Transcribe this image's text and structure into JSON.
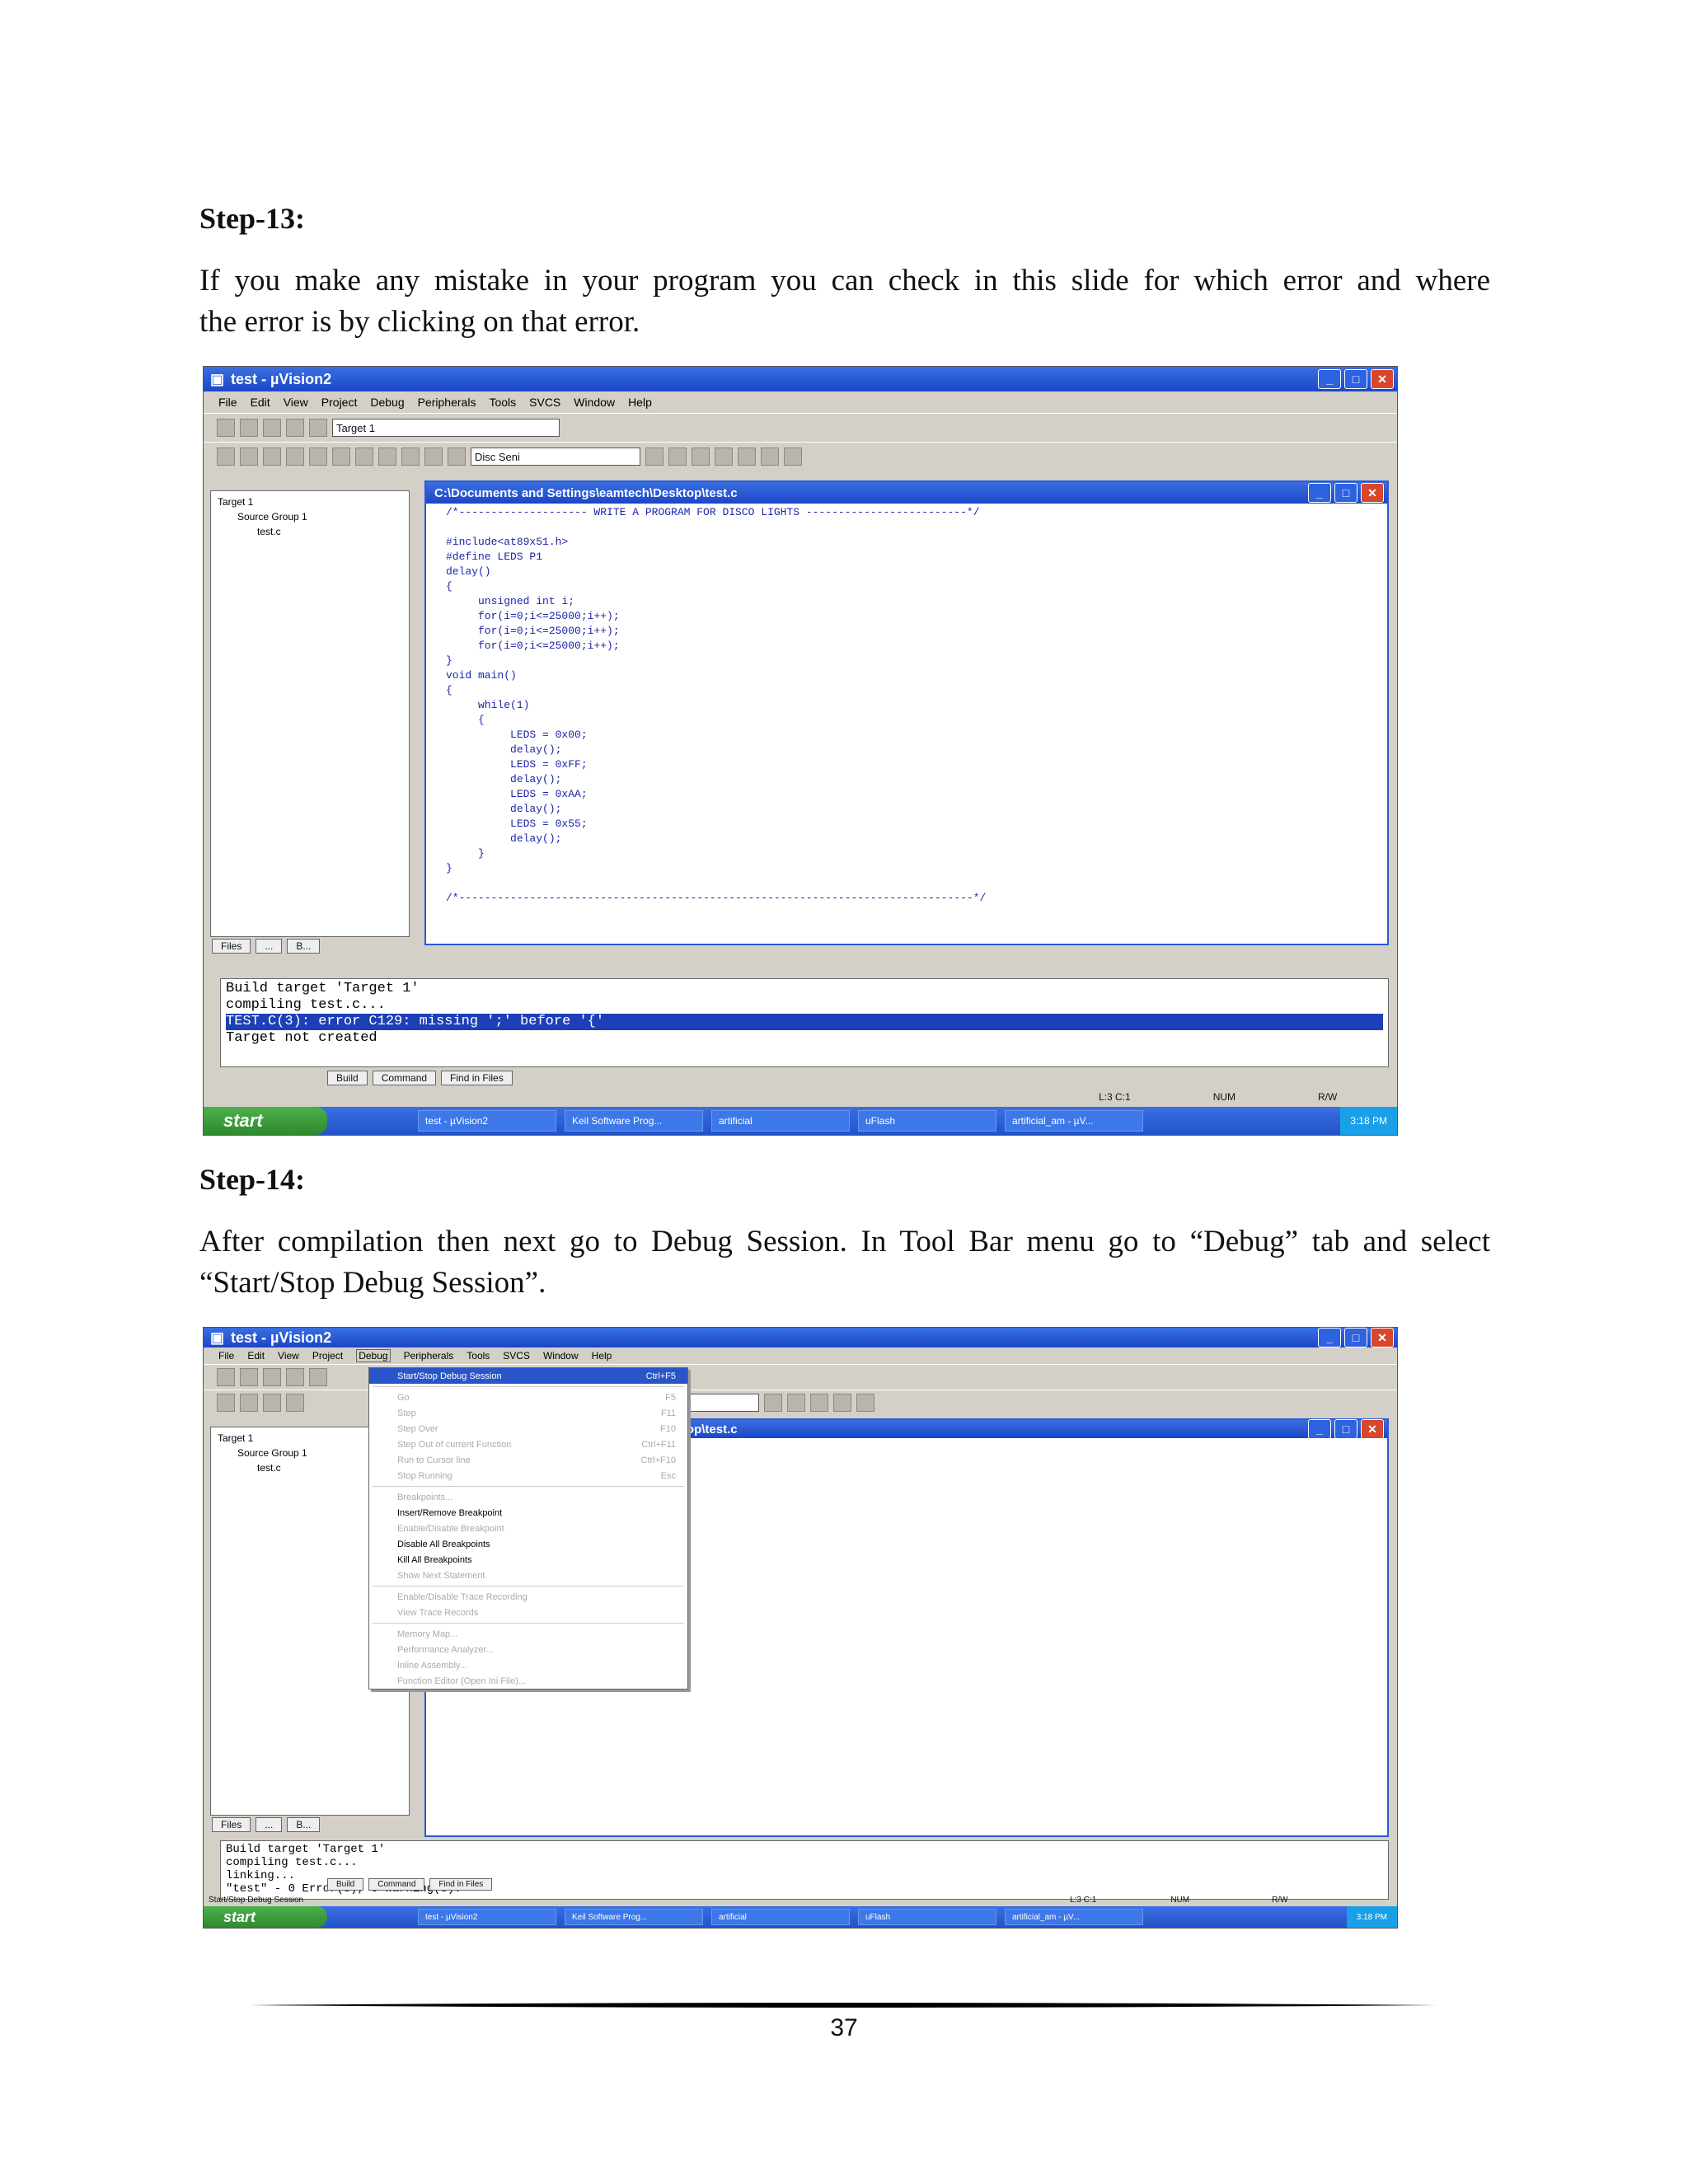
{
  "step13": {
    "heading": "Step-13:",
    "text_line1": "If you make any mistake in your program you can check in this slide for which error and where",
    "text_line2": "the error is by clicking  on that error."
  },
  "step14": {
    "heading": "Step-14:",
    "text_line1": "After compilation then next go to Debug Session. In Tool Bar menu go to “Debug” tab and select",
    "text_line2": "“Start/Stop  Debug  Session”."
  },
  "ide": {
    "title": "test - µVision2",
    "menu": [
      "File",
      "Edit",
      "View",
      "Project",
      "Debug",
      "Peripherals",
      "Tools",
      "SVCS",
      "Window",
      "Help"
    ],
    "target": "Target 1",
    "find_combo": "Disc Seni",
    "tree": {
      "target": "Target 1",
      "group": "Source Group 1",
      "file": "test.c"
    },
    "proj_tabs": [
      "Files",
      "...",
      "B..."
    ],
    "editor_title": "C:\\Documents and Settings\\eamtech\\Desktop\\test.c",
    "code": "/*-------------------- WRITE A PROGRAM FOR DISCO LIGHTS -------------------------*/\n\n#include<at89x51.h>\n#define LEDS P1\ndelay()\n{\n     unsigned int i;\n     for(i=0;i<=25000;i++);\n     for(i=0;i<=25000;i++);\n     for(i=0;i<=25000;i++);\n}\nvoid main()\n{\n     while(1)\n     {\n          LEDS = 0x00;\n          delay();\n          LEDS = 0xFF;\n          delay();\n          LEDS = 0xAA;\n          delay();\n          LEDS = 0x55;\n          delay();\n     }\n}\n\n/*--------------------------------------------------------------------------------*/",
    "output1": [
      "Build target 'Target 1'",
      "compiling test.c...",
      "TEST.C(3): error C129: missing ';' before '{'",
      "Target not created"
    ],
    "output2": [
      "Build target 'Target 1'",
      "compiling test.c...",
      "linking...",
      "\"test\" - 0 Error(s), 0 Warning(s)."
    ],
    "out_tabs": [
      "Build",
      "Command",
      "Find in Files"
    ],
    "status_pos": "L:3 C:1",
    "status_num": "NUM",
    "status_rw": "R/W",
    "status2_left": "Start/Stop Debug Session",
    "taskbar": {
      "start": "start",
      "items": [
        "test - µVision2",
        "Keil Software Prog...",
        "artificial",
        "uFlash",
        "artificial_am - µV..."
      ],
      "clock": "3:18 PM"
    },
    "debug_menu": [
      {
        "label": "Start/Stop Debug Session",
        "sc": "Ctrl+F5",
        "state": "sel"
      },
      {
        "sep": true
      },
      {
        "label": "Go",
        "sc": "F5",
        "state": "dis"
      },
      {
        "label": "Step",
        "sc": "F11",
        "state": "dis"
      },
      {
        "label": "Step Over",
        "sc": "F10",
        "state": "dis"
      },
      {
        "label": "Step Out of current Function",
        "sc": "Ctrl+F11",
        "state": "dis"
      },
      {
        "label": "Run to Cursor line",
        "sc": "Ctrl+F10",
        "state": "dis"
      },
      {
        "label": "Stop Running",
        "sc": "Esc",
        "state": "dis"
      },
      {
        "sep": true
      },
      {
        "label": "Breakpoints...",
        "sc": "",
        "state": "dis"
      },
      {
        "label": "Insert/Remove Breakpoint",
        "sc": "",
        "state": ""
      },
      {
        "label": "Enable/Disable Breakpoint",
        "sc": "",
        "state": "dis"
      },
      {
        "label": "Disable All Breakpoints",
        "sc": "",
        "state": ""
      },
      {
        "label": "Kill All Breakpoints",
        "sc": "",
        "state": ""
      },
      {
        "label": "Show Next Statement",
        "sc": "",
        "state": "dis"
      },
      {
        "sep": true
      },
      {
        "label": "Enable/Disable Trace Recording",
        "sc": "",
        "state": "dis"
      },
      {
        "label": "View Trace Records",
        "sc": "",
        "state": "dis"
      },
      {
        "sep": true
      },
      {
        "label": "Memory Map...",
        "sc": "",
        "state": "dis"
      },
      {
        "label": "Performance Analyzer...",
        "sc": "",
        "state": "dis"
      },
      {
        "label": "Inline Assembly...",
        "sc": "",
        "state": "dis"
      },
      {
        "label": "Function Editor (Open Ini File)...",
        "sc": "",
        "state": "dis"
      }
    ]
  },
  "page_number": "37"
}
